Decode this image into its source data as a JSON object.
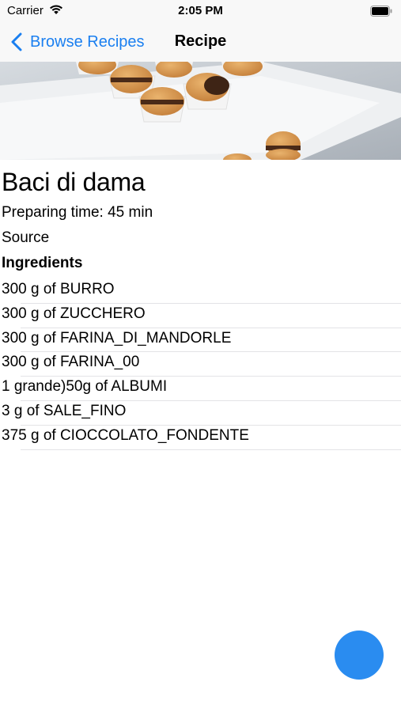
{
  "status_bar": {
    "carrier": "Carrier",
    "time": "2:05 PM"
  },
  "nav": {
    "back_label": "Browse Recipes",
    "title": "Recipe",
    "accent_color": "#1a7ff0"
  },
  "recipe": {
    "title": "Baci di dama",
    "preparing_time": "Preparing time: 45 min",
    "source_label": "Source",
    "ingredients_header": "Ingredients",
    "ingredients": [
      "300 g of BURRO",
      "300 g of ZUCCHERO",
      "300 g of FARINA_DI_MANDORLE",
      "300 g of FARINA_00",
      "1 grande)50g of ALBUMI",
      "3 g of SALE_FINO",
      "375 g of CIOCCOLATO_FONDENTE"
    ]
  },
  "fab": {
    "color": "#2a8cf0"
  }
}
